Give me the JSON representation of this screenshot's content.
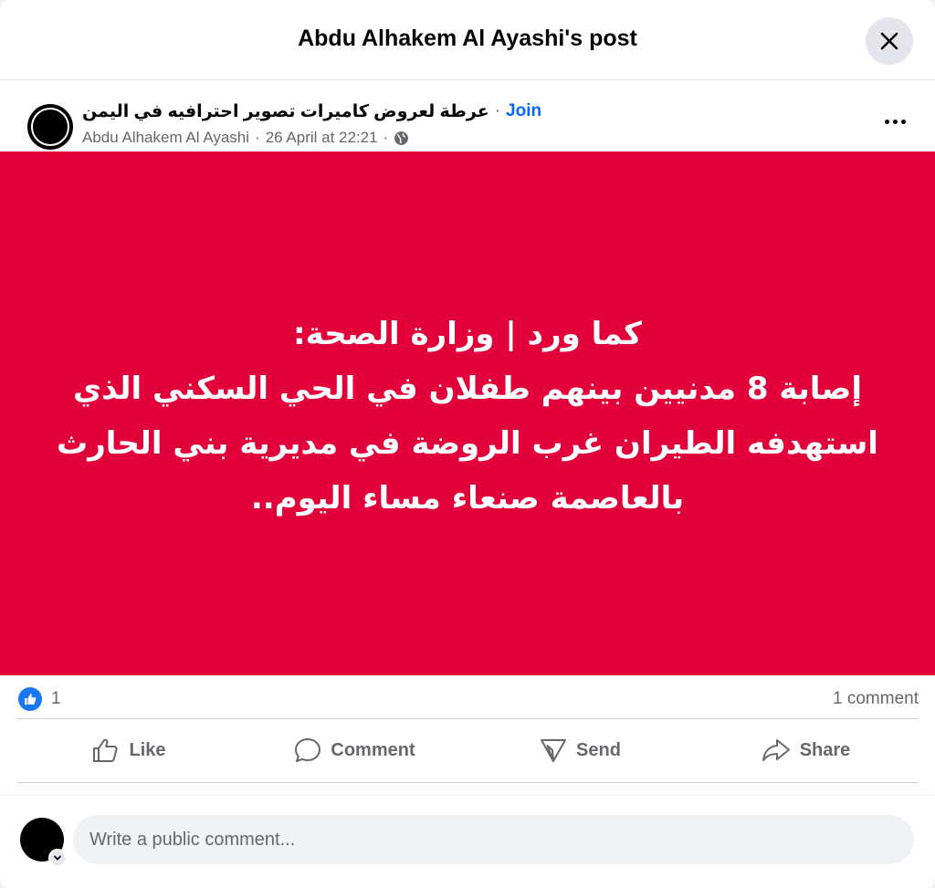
{
  "modal": {
    "title": "Abdu Alhakem Al Ayashi's post",
    "close_icon": "close-icon"
  },
  "post": {
    "group_name": "عرطة لعروض كاميرات تصوير احترافيه في اليمن",
    "separator": "·",
    "join_label": "Join",
    "author": "Abdu Alhakem Al Ayashi",
    "timestamp": "26 April at 22:21",
    "privacy_icon": "globe-icon",
    "more_icon": "more-options-icon",
    "background_color": "#e1003a",
    "text_lines": [
      "كما ورد | وزارة الصحة:",
      "إصابة 8 مدنيين بينهم طفلان في الحي السكني الذي",
      "استهدفه الطيران غرب الروضة في مديرية بني الحارث",
      "بالعاصمة صنعاء مساء اليوم.."
    ]
  },
  "stats": {
    "like_count": "1",
    "comment_count": "1 comment"
  },
  "actions": {
    "like": "Like",
    "comment": "Comment",
    "send": "Send",
    "share": "Share"
  },
  "composer": {
    "placeholder": "Write a public comment..."
  },
  "colors": {
    "accent": "#0866ff",
    "like_blue": "#1877f2",
    "secondary_text": "#65676b"
  }
}
